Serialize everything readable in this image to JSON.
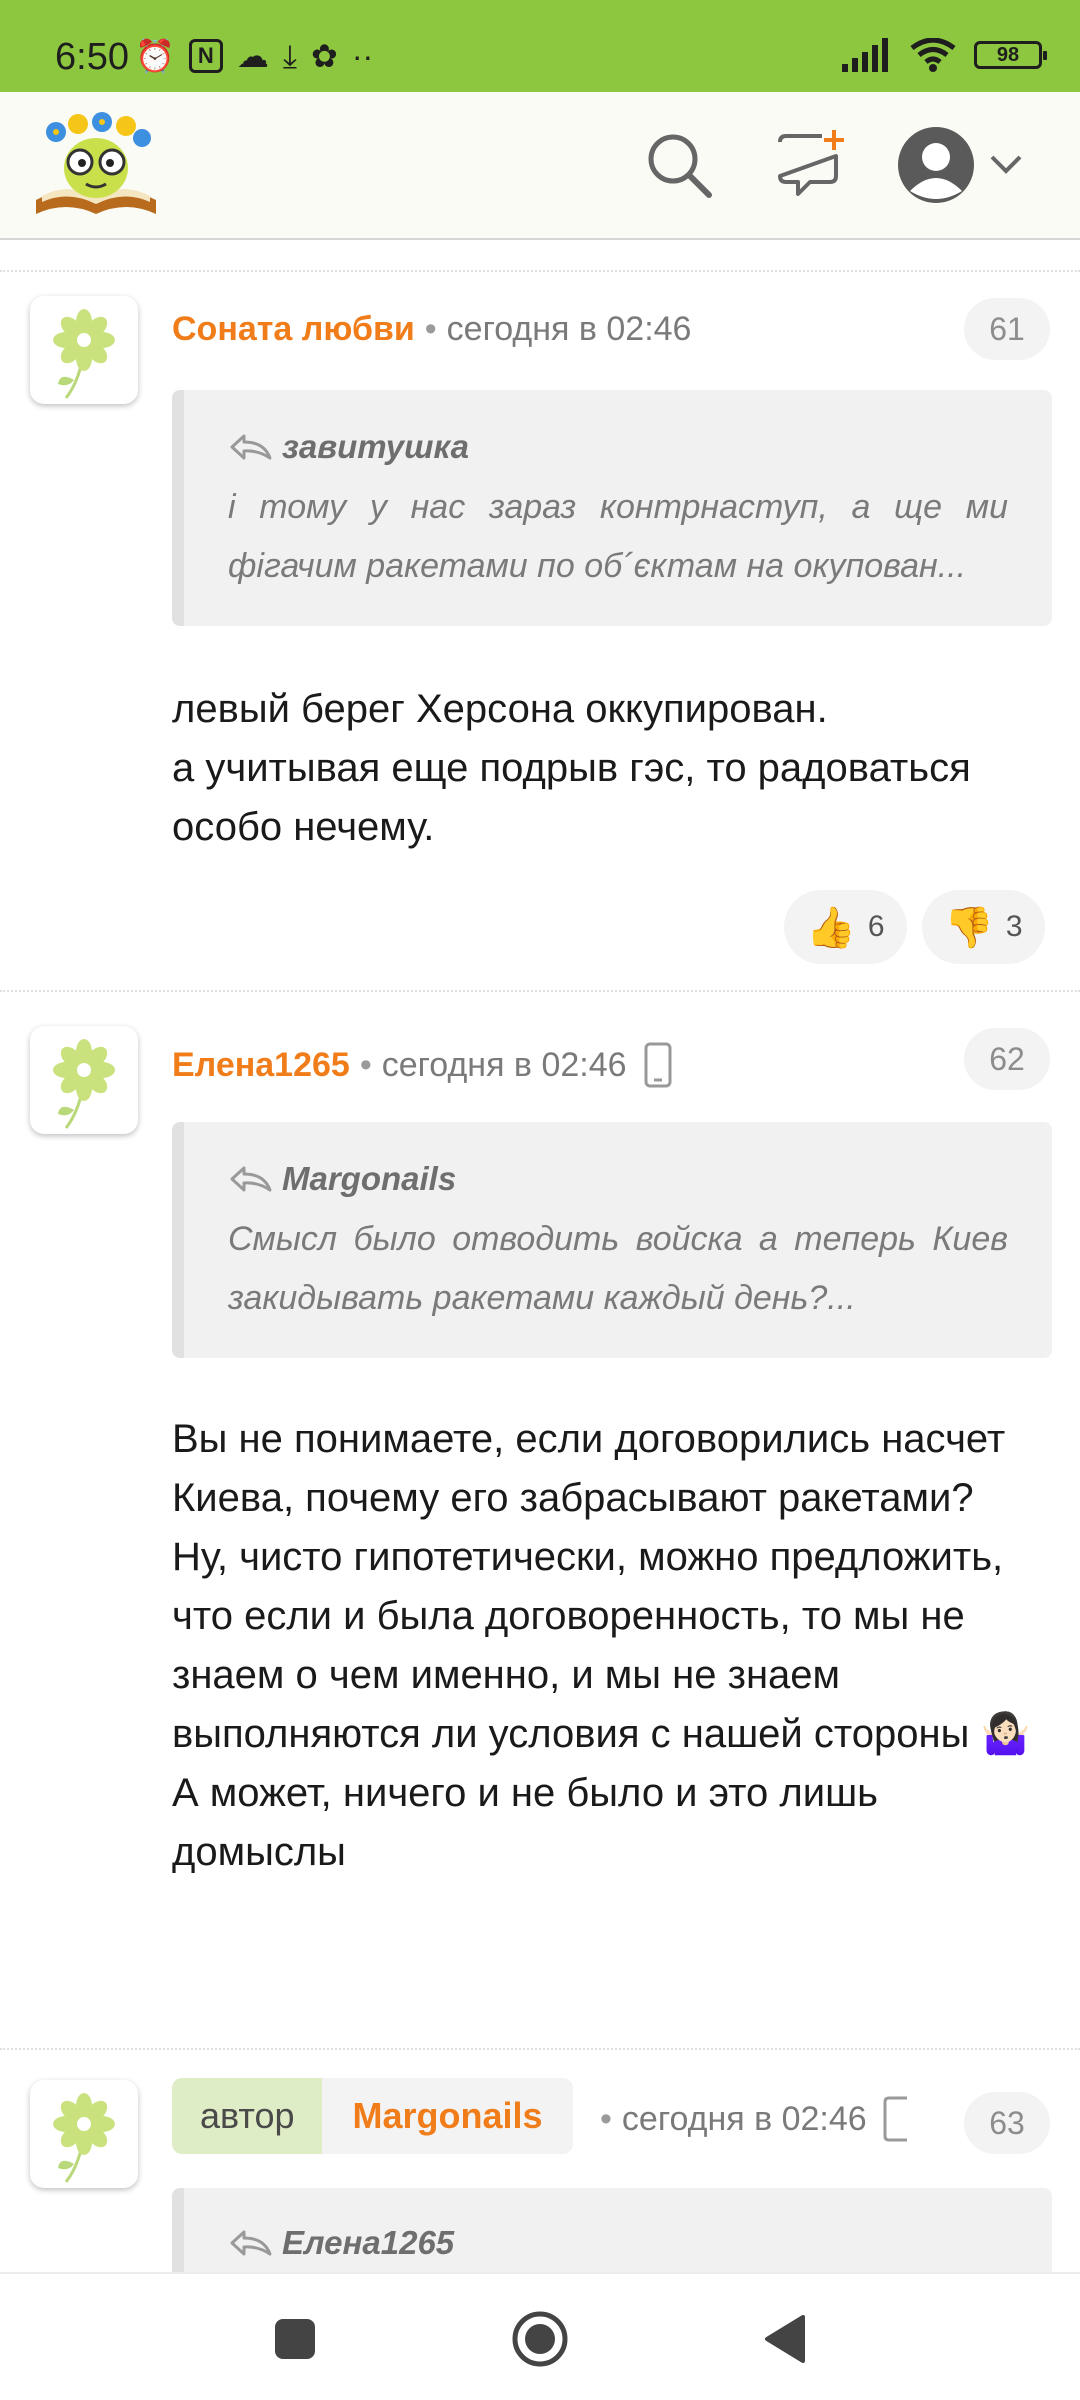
{
  "status": {
    "time": "6:50",
    "battery": "98",
    "left_icons": [
      "alarm-icon",
      "nfc-icon",
      "cloud-icon",
      "download-icon",
      "app-icon",
      "more-dots-icon"
    ]
  },
  "header": {
    "logo_alt": "logo",
    "icons": [
      "search-icon",
      "new-message-icon",
      "avatar-icon",
      "chevron-down-icon"
    ]
  },
  "comments": [
    {
      "author": "Соната любви",
      "time": "сегодня в 02:46",
      "number": "61",
      "quote_author": "завитушка",
      "quote_text": "і тому у нас зараз контрнаступ, а ще ми фігачим ракетами по об´єктам на окупован...",
      "text": "левый берег Херсона оккупирован.\nа учитывая еще подрыв гэс, то радоваться особо нечему.",
      "likes": "6",
      "dislikes": "3"
    },
    {
      "author": "Елена1265",
      "time": "сегодня в 02:46",
      "number": "62",
      "quote_author": "Margonails",
      "quote_text": "Смысл было отводить войска а теперь Киев закидывать ракетами каждый день?...",
      "text": "Вы не понимаете, если договорились насчет Киева, почему его забрасывают ракетами?\nНу, чисто гипотетически, можно предложить, что если и была договоренность, то мы не знаем о чем именно, и мы не знаем выполняются ли условия с нашей стороны 🤷🏻‍♀️\nА может, ничего и не было и это лишь домыслы"
    },
    {
      "author_label": "автор",
      "author": "Margonails",
      "time": "сегодня в 02:46",
      "number": "63",
      "quote_author": "Елена1265"
    }
  ]
}
